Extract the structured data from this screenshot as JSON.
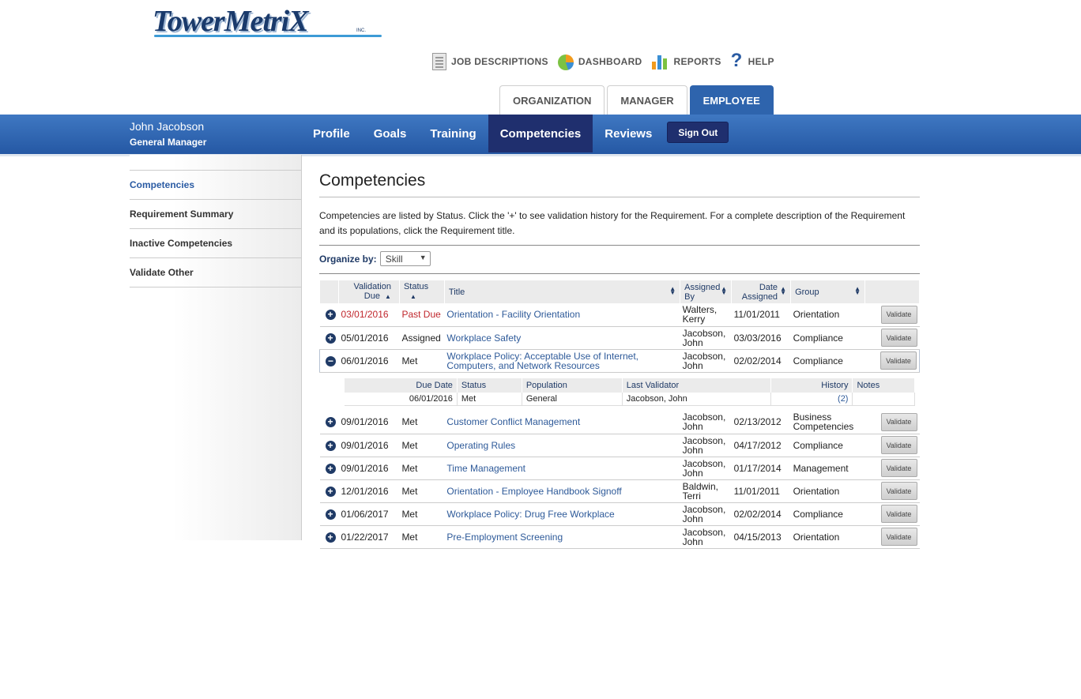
{
  "brand": {
    "name": "TowerMetrix",
    "logo_text": "TowerMetriX",
    "inc": "INC."
  },
  "topnav": [
    {
      "label": "JOB DESCRIPTIONS",
      "icon": "document-icon"
    },
    {
      "label": "DASHBOARD",
      "icon": "pie-chart-icon"
    },
    {
      "label": "REPORTS",
      "icon": "bar-chart-icon"
    },
    {
      "label": "HELP",
      "icon": "question-icon"
    }
  ],
  "role_tabs": [
    "ORGANIZATION",
    "MANAGER",
    "EMPLOYEE"
  ],
  "user": {
    "name": "John Jacobson",
    "title": "General Manager"
  },
  "mainnav": [
    "Profile",
    "Goals",
    "Training",
    "Competencies",
    "Reviews"
  ],
  "signout": "Sign Out",
  "sidebar": [
    "Competencies",
    "Requirement Summary",
    "Inactive Competencies",
    "Validate Other"
  ],
  "page": {
    "title": "Competencies",
    "description": "Competencies are listed by Status. Click the '+' to see validation history for the Requirement. For a complete description of the Requirement and its populations, click the Requirement title.",
    "organize_label": "Organize by:",
    "organize_value": "Skill"
  },
  "table": {
    "headers": {
      "validation_due": "Validation Due",
      "status": "Status",
      "title": "Title",
      "assigned_by": "Assigned By",
      "date_assigned": "Date Assigned",
      "group": "Group"
    },
    "validate_label": "Validate",
    "rows": [
      {
        "due": "03/01/2016",
        "status": "Past Due",
        "title": "Orientation - Facility Orientation",
        "by": "Walters, Kerry",
        "assigned": "11/01/2011",
        "group": "Orientation",
        "expanded": false
      },
      {
        "due": "05/01/2016",
        "status": "Assigned",
        "title": "Workplace Safety",
        "by": "Jacobson, John",
        "assigned": "03/03/2016",
        "group": "Compliance",
        "expanded": false
      },
      {
        "due": "06/01/2016",
        "status": "Met",
        "title": "Workplace Policy: Acceptable Use of Internet, Computers, and Network Resources",
        "by": "Jacobson, John",
        "assigned": "02/02/2014",
        "group": "Compliance",
        "expanded": true
      },
      {
        "due": "09/01/2016",
        "status": "Met",
        "title": "Customer Conflict Management",
        "by": "Jacobson, John",
        "assigned": "02/13/2012",
        "group": "Business Competencies",
        "expanded": false
      },
      {
        "due": "09/01/2016",
        "status": "Met",
        "title": "Operating Rules",
        "by": "Jacobson, John",
        "assigned": "04/17/2012",
        "group": "Compliance",
        "expanded": false
      },
      {
        "due": "09/01/2016",
        "status": "Met",
        "title": "Time Management",
        "by": "Jacobson, John",
        "assigned": "01/17/2014",
        "group": "Management",
        "expanded": false
      },
      {
        "due": "12/01/2016",
        "status": "Met",
        "title": "Orientation - Employee Handbook Signoff",
        "by": "Baldwin, Terri",
        "assigned": "11/01/2011",
        "group": "Orientation",
        "expanded": false
      },
      {
        "due": "01/06/2017",
        "status": "Met",
        "title": "Workplace Policy: Drug Free Workplace",
        "by": "Jacobson, John",
        "assigned": "02/02/2014",
        "group": "Compliance",
        "expanded": false
      },
      {
        "due": "01/22/2017",
        "status": "Met",
        "title": "Pre-Employment Screening",
        "by": "Jacobson, John",
        "assigned": "04/15/2013",
        "group": "Orientation",
        "expanded": false
      }
    ],
    "history": {
      "headers": [
        "Due Date",
        "Status",
        "Population",
        "Last Validator",
        "History",
        "Notes"
      ],
      "rows": [
        {
          "due": "06/01/2016",
          "status": "Met",
          "population": "General",
          "validator": "Jacobson, John",
          "history": "(2)",
          "notes": ""
        }
      ]
    }
  },
  "colors": {
    "primary_blue": "#2e64ad",
    "nav_dark": "#1f2f6e",
    "past_due": "#c0272d",
    "link": "#2e5a99"
  }
}
